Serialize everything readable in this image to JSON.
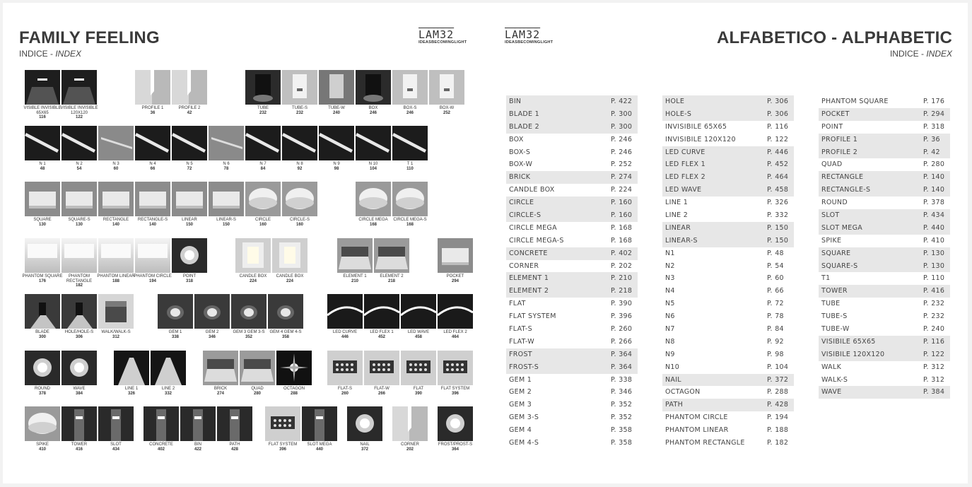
{
  "left_page": {
    "title": "FAMILY FEELING",
    "subtitle_plain": "INDICE - ",
    "subtitle_italic": "INDEX"
  },
  "right_page": {
    "title": "ALFABETICO - ALPHABETIC",
    "subtitle_plain": "INDICE - ",
    "subtitle_italic": "INDEX"
  },
  "logo": {
    "wordmark": "LAM32",
    "tagline": "IDEASBECOMINGLIGHT"
  },
  "colors": {
    "band": "#e7e7e7",
    "text": "#3a3a3a"
  },
  "products": [
    {
      "label": "VISIBLE INVISIBLE 65X65",
      "page": "116",
      "style": "dark-slot"
    },
    {
      "label": "VISIBLE INVISIBLE 120X120",
      "page": "122",
      "style": "dark-slot"
    },
    {
      "label": "PROFILE 1",
      "page": "36",
      "style": "corner"
    },
    {
      "label": "PROFILE 2",
      "page": "42",
      "style": "corner"
    },
    {
      "label": "TUBE",
      "page": "232",
      "style": "dark-box"
    },
    {
      "label": "TUBE-S",
      "page": "232",
      "style": "white-tube"
    },
    {
      "label": "TUBE-W",
      "page": "240",
      "style": "grey-tube"
    },
    {
      "label": "BOX",
      "page": "246",
      "style": "dark-box"
    },
    {
      "label": "BOX-S",
      "page": "246",
      "style": "white-tube"
    },
    {
      "label": "BOX-W",
      "page": "252",
      "style": "white-tube"
    },
    {
      "label": "N 1",
      "page": "48",
      "style": "linear-dark"
    },
    {
      "label": "N 2",
      "page": "54",
      "style": "linear-dark"
    },
    {
      "label": "N 3",
      "page": "60",
      "style": "linear-grey"
    },
    {
      "label": "N 4",
      "page": "66",
      "style": "linear-dark"
    },
    {
      "label": "N 5",
      "page": "72",
      "style": "linear-dark"
    },
    {
      "label": "N 6",
      "page": "78",
      "style": "linear-grey"
    },
    {
      "label": "N 7",
      "page": "84",
      "style": "linear-dark"
    },
    {
      "label": "N 8",
      "page": "92",
      "style": "linear-dark"
    },
    {
      "label": "N 9",
      "page": "98",
      "style": "linear-dark"
    },
    {
      "label": "N 10",
      "page": "104",
      "style": "linear-dark"
    },
    {
      "label": "T 1",
      "page": "110",
      "style": "linear-dark"
    },
    {
      "label": "SQUARE",
      "page": "130",
      "style": "panel"
    },
    {
      "label": "SQUARE-S",
      "page": "130",
      "style": "panel"
    },
    {
      "label": "RECTANGLE",
      "page": "140",
      "style": "panel"
    },
    {
      "label": "RECTANGLE-S",
      "page": "140",
      "style": "panel"
    },
    {
      "label": "LINEAR",
      "page": "150",
      "style": "panel"
    },
    {
      "label": "LINEAR-S",
      "page": "150",
      "style": "panel"
    },
    {
      "label": "CIRCLE",
      "page": "160",
      "style": "round"
    },
    {
      "label": "CIRCLE-S",
      "page": "160",
      "style": "round"
    },
    {
      "label": "CIRCLE MEGA",
      "page": "168",
      "style": "round"
    },
    {
      "label": "CIRCLE MEGA-S",
      "page": "168",
      "style": "round"
    },
    {
      "label": "PHANTOM SQUARE",
      "page": "176",
      "style": "phantom"
    },
    {
      "label": "PHANTOM RECTANGLE",
      "page": "182",
      "style": "phantom"
    },
    {
      "label": "PHANTOM LINEAR",
      "page": "188",
      "style": "phantom"
    },
    {
      "label": "PHANTOM CIRCLE",
      "page": "194",
      "style": "phantom"
    },
    {
      "label": "POINT",
      "page": "318",
      "style": "spot"
    },
    {
      "label": "CANDLE BOX",
      "page": "224",
      "style": "candle"
    },
    {
      "label": "CANDLE BOX",
      "page": "224",
      "style": "candle"
    },
    {
      "label": "ELEMENT 1",
      "page": "210",
      "style": "element"
    },
    {
      "label": "ELEMENT 2",
      "page": "218",
      "style": "element"
    },
    {
      "label": "POCKET",
      "page": "294",
      "style": "panel"
    },
    {
      "label": "BLADE",
      "page": "300",
      "style": "blade"
    },
    {
      "label": "HOLE/HOLE-S",
      "page": "306",
      "style": "blade"
    },
    {
      "label": "WALK/WALK-S",
      "page": "312",
      "style": "cube"
    },
    {
      "label": "GEM 1",
      "page": "338",
      "style": "gem"
    },
    {
      "label": "GEM 2",
      "page": "346",
      "style": "gem"
    },
    {
      "label": "GEM 3 GEM 3-S",
      "page": "352",
      "style": "gem"
    },
    {
      "label": "GEM 4 GEM 4-S",
      "page": "358",
      "style": "gem"
    },
    {
      "label": "LED CURVE",
      "page": "446",
      "style": "led"
    },
    {
      "label": "LED FLEX 1",
      "page": "452",
      "style": "led"
    },
    {
      "label": "LED WAVE",
      "page": "458",
      "style": "led"
    },
    {
      "label": "LED FLEX 2",
      "page": "464",
      "style": "led"
    },
    {
      "label": "ROUND",
      "page": "378",
      "style": "spot"
    },
    {
      "label": "WAVE",
      "page": "384",
      "style": "spot"
    },
    {
      "label": "LINE 1",
      "page": "326",
      "style": "beam"
    },
    {
      "label": "LINE 2",
      "page": "332",
      "style": "beam"
    },
    {
      "label": "BRICK",
      "page": "274",
      "style": "element"
    },
    {
      "label": "QUAD",
      "page": "280",
      "style": "element"
    },
    {
      "label": "OCTAGON",
      "page": "288",
      "style": "star"
    },
    {
      "label": "FLAT-S",
      "page": "260",
      "style": "grid"
    },
    {
      "label": "FLAT-W",
      "page": "266",
      "style": "grid"
    },
    {
      "label": "FLAT",
      "page": "390",
      "style": "grid"
    },
    {
      "label": "FLAT SYSTEM",
      "page": "396",
      "style": "grid"
    },
    {
      "label": "SPIKE",
      "page": "410",
      "style": "round"
    },
    {
      "label": "TOWER",
      "page": "416",
      "style": "bollard"
    },
    {
      "label": "SLOT",
      "page": "434",
      "style": "bollard"
    },
    {
      "label": "CONCRETE",
      "page": "402",
      "style": "bollard"
    },
    {
      "label": "BIN",
      "page": "422",
      "style": "bollard"
    },
    {
      "label": "PATH",
      "page": "428",
      "style": "bollard"
    },
    {
      "label": "FLAT SYSTEM",
      "page": "396",
      "style": "grid"
    },
    {
      "label": "SLOT MEGA",
      "page": "440",
      "style": "bollard"
    },
    {
      "label": "NAIL",
      "page": "372",
      "style": "spot"
    },
    {
      "label": "CORNER",
      "page": "202",
      "style": "corner"
    },
    {
      "label": "FROST/PROST-S",
      "page": "364",
      "style": "spot"
    }
  ],
  "index_columns": [
    [
      {
        "name": "BIN",
        "page": "P. 422",
        "band": true
      },
      {
        "name": "BLADE 1",
        "page": "P. 300",
        "band": true
      },
      {
        "name": "BLADE 2",
        "page": "P. 300",
        "band": true
      },
      {
        "name": "BOX",
        "page": "P. 246",
        "band": false
      },
      {
        "name": "BOX-S",
        "page": "P. 246",
        "band": false
      },
      {
        "name": "BOX-W",
        "page": "P. 252",
        "band": false
      },
      {
        "name": "BRICK",
        "page": "P. 274",
        "band": true
      },
      {
        "name": "CANDLE BOX",
        "page": "P. 224",
        "band": false
      },
      {
        "name": "CIRCLE",
        "page": "P. 160",
        "band": true
      },
      {
        "name": "CIRCLE-S",
        "page": "P. 160",
        "band": true
      },
      {
        "name": "CIRCLE MEGA",
        "page": "P. 168",
        "band": false
      },
      {
        "name": "CIRCLE MEGA-S",
        "page": "P. 168",
        "band": false
      },
      {
        "name": "CONCRETE",
        "page": "P. 402",
        "band": true
      },
      {
        "name": "CORNER",
        "page": "P. 202",
        "band": false
      },
      {
        "name": "ELEMENT 1",
        "page": "P. 210",
        "band": true
      },
      {
        "name": "ELEMENT 2",
        "page": "P. 218",
        "band": true
      },
      {
        "name": "FLAT",
        "page": "P. 390",
        "band": false
      },
      {
        "name": "FLAT SYSTEM",
        "page": "P. 396",
        "band": false
      },
      {
        "name": "FLAT-S",
        "page": "P. 260",
        "band": false
      },
      {
        "name": "FLAT-W",
        "page": "P. 266",
        "band": false
      },
      {
        "name": "FROST",
        "page": "P. 364",
        "band": true
      },
      {
        "name": "FROST-S",
        "page": "P. 364",
        "band": true
      },
      {
        "name": "GEM 1",
        "page": "P. 338",
        "band": false
      },
      {
        "name": "GEM 2",
        "page": "P. 346",
        "band": false
      },
      {
        "name": "GEM 3",
        "page": "P. 352",
        "band": false
      },
      {
        "name": "GEM 3-S",
        "page": "P. 352",
        "band": false
      },
      {
        "name": "GEM 4",
        "page": "P. 358",
        "band": false
      },
      {
        "name": "GEM 4-S",
        "page": "P. 358",
        "band": false
      }
    ],
    [
      {
        "name": "HOLE",
        "page": "P. 306",
        "band": true
      },
      {
        "name": "HOLE-S",
        "page": "P. 306",
        "band": true
      },
      {
        "name": "INVISIBILE 65X65",
        "page": "P. 116",
        "band": false
      },
      {
        "name": "INVISIBILE 120X120",
        "page": "P. 122",
        "band": false
      },
      {
        "name": "LED CURVE",
        "page": "P. 446",
        "band": true
      },
      {
        "name": "LED FLEX 1",
        "page": "P. 452",
        "band": true
      },
      {
        "name": "LED FLEX 2",
        "page": "P. 464",
        "band": true
      },
      {
        "name": "LED WAVE",
        "page": "P. 458",
        "band": true
      },
      {
        "name": "LINE 1",
        "page": "P. 326",
        "band": false
      },
      {
        "name": "LINE 2",
        "page": "P. 332",
        "band": false
      },
      {
        "name": "LINEAR",
        "page": "P. 150",
        "band": true
      },
      {
        "name": "LINEAR-S",
        "page": "P. 150",
        "band": true
      },
      {
        "name": "N1",
        "page": "P. 48",
        "band": false
      },
      {
        "name": "N2",
        "page": "P. 54",
        "band": false
      },
      {
        "name": "N3",
        "page": "P. 60",
        "band": false
      },
      {
        "name": "N4",
        "page": "P. 66",
        "band": false
      },
      {
        "name": "N5",
        "page": "P. 72",
        "band": false
      },
      {
        "name": "N6",
        "page": "P. 78",
        "band": false
      },
      {
        "name": "N7",
        "page": "P. 84",
        "band": false
      },
      {
        "name": "N8",
        "page": "P. 92",
        "band": false
      },
      {
        "name": "N9",
        "page": "P. 98",
        "band": false
      },
      {
        "name": "N10",
        "page": "P. 104",
        "band": false
      },
      {
        "name": "NAIL",
        "page": "P. 372",
        "band": true
      },
      {
        "name": "OCTAGON",
        "page": "P. 288",
        "band": false
      },
      {
        "name": "PATH",
        "page": "P. 428",
        "band": true
      },
      {
        "name": "PHANTOM CIRCLE",
        "page": "P. 194",
        "band": false
      },
      {
        "name": "PHANTOM LINEAR",
        "page": "P. 188",
        "band": false
      },
      {
        "name": "PHANTOM RECTANGLE",
        "page": "P. 182",
        "band": false
      }
    ],
    [
      {
        "name": "PHANTOM SQUARE",
        "page": "P. 176",
        "band": false
      },
      {
        "name": "POCKET",
        "page": "P. 294",
        "band": true
      },
      {
        "name": "POINT",
        "page": "P. 318",
        "band": false
      },
      {
        "name": "PROFILE 1",
        "page": "P. 36",
        "band": true
      },
      {
        "name": "PROFILE 2",
        "page": "P. 42",
        "band": true
      },
      {
        "name": "QUAD",
        "page": "P. 280",
        "band": false
      },
      {
        "name": "RECTANGLE",
        "page": "P. 140",
        "band": true
      },
      {
        "name": "RECTANGLE-S",
        "page": "P. 140",
        "band": true
      },
      {
        "name": "ROUND",
        "page": "P. 378",
        "band": false
      },
      {
        "name": "SLOT",
        "page": "P. 434",
        "band": true
      },
      {
        "name": "SLOT MEGA",
        "page": "P. 440",
        "band": true
      },
      {
        "name": "SPIKE",
        "page": "P. 410",
        "band": false
      },
      {
        "name": "SQUARE",
        "page": "P. 130",
        "band": true
      },
      {
        "name": "SQUARE-S",
        "page": "P. 130",
        "band": true
      },
      {
        "name": "T1",
        "page": "P. 110",
        "band": false
      },
      {
        "name": "TOWER",
        "page": "P. 416",
        "band": true
      },
      {
        "name": "TUBE",
        "page": "P. 232",
        "band": false
      },
      {
        "name": "TUBE-S",
        "page": "P. 232",
        "band": false
      },
      {
        "name": "TUBE-W",
        "page": "P. 240",
        "band": false
      },
      {
        "name": "VISIBILE 65X65",
        "page": "P. 116",
        "band": true
      },
      {
        "name": "VISIBILE 120X120",
        "page": "P. 122",
        "band": true
      },
      {
        "name": "WALK",
        "page": "P. 312",
        "band": false
      },
      {
        "name": "WALK-S",
        "page": "P. 312",
        "band": false
      },
      {
        "name": "WAVE",
        "page": "P. 384",
        "band": true
      }
    ]
  ]
}
